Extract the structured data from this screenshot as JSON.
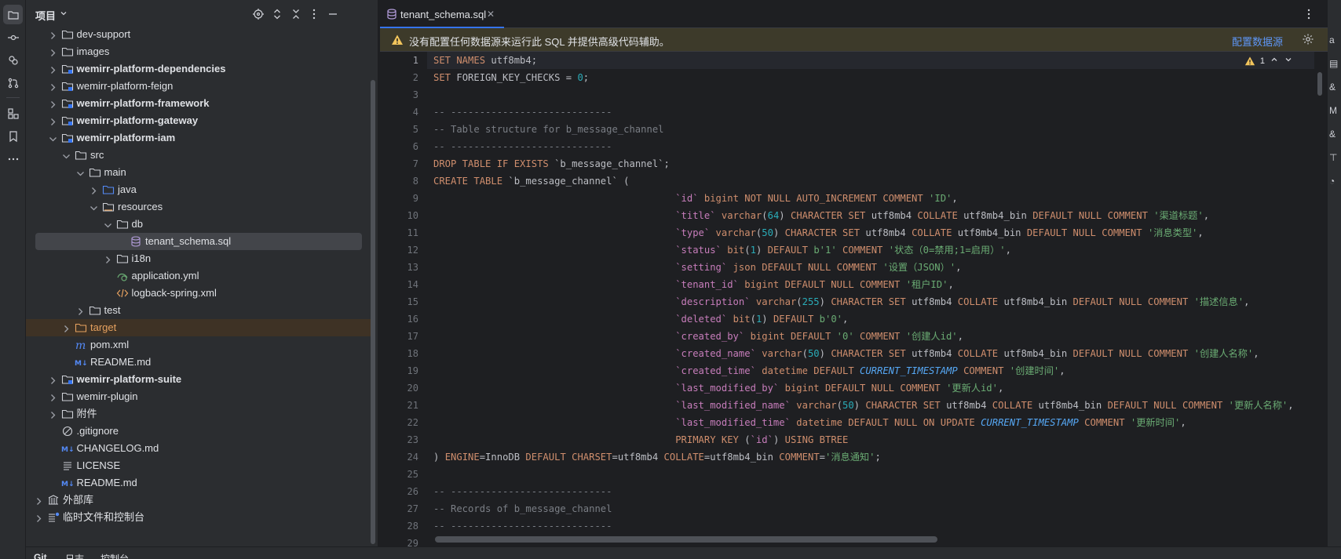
{
  "project_panel": {
    "title": "项目",
    "tree": [
      {
        "label": "dev-support",
        "depth": 1,
        "kind": "folder",
        "chev": "right",
        "bold": false
      },
      {
        "label": "images",
        "depth": 1,
        "kind": "folder",
        "chev": "right",
        "bold": false
      },
      {
        "label": "wemirr-platform-dependencies",
        "depth": 1,
        "kind": "module",
        "chev": "right",
        "bold": true
      },
      {
        "label": "wemirr-platform-feign",
        "depth": 1,
        "kind": "module",
        "chev": "right",
        "bold": false
      },
      {
        "label": "wemirr-platform-framework",
        "depth": 1,
        "kind": "module",
        "chev": "right",
        "bold": true
      },
      {
        "label": "wemirr-platform-gateway",
        "depth": 1,
        "kind": "module",
        "chev": "right",
        "bold": true
      },
      {
        "label": "wemirr-platform-iam",
        "depth": 1,
        "kind": "module",
        "chev": "down",
        "bold": true
      },
      {
        "label": "src",
        "depth": 2,
        "kind": "folder",
        "chev": "down",
        "bold": false
      },
      {
        "label": "main",
        "depth": 3,
        "kind": "folder",
        "chev": "down",
        "bold": false
      },
      {
        "label": "java",
        "depth": 4,
        "kind": "source",
        "chev": "right",
        "bold": false
      },
      {
        "label": "resources",
        "depth": 4,
        "kind": "resources",
        "chev": "down",
        "bold": false
      },
      {
        "label": "db",
        "depth": 5,
        "kind": "folder",
        "chev": "down",
        "bold": false
      },
      {
        "label": "tenant_schema.sql",
        "depth": 6,
        "kind": "sql",
        "chev": "none",
        "bold": false,
        "selected": true
      },
      {
        "label": "i18n",
        "depth": 5,
        "kind": "folder",
        "chev": "right",
        "bold": false
      },
      {
        "label": "application.yml",
        "depth": 5,
        "kind": "yml",
        "chev": "none",
        "bold": false
      },
      {
        "label": "logback-spring.xml",
        "depth": 5,
        "kind": "xml",
        "chev": "none",
        "bold": false
      },
      {
        "label": "test",
        "depth": 3,
        "kind": "folder",
        "chev": "right",
        "bold": false
      },
      {
        "label": "target",
        "depth": 2,
        "kind": "excluded",
        "chev": "right",
        "bold": false
      },
      {
        "label": "pom.xml",
        "depth": 2,
        "kind": "maven",
        "chev": "none",
        "bold": false
      },
      {
        "label": "README.md",
        "depth": 2,
        "kind": "md",
        "chev": "none",
        "bold": false
      },
      {
        "label": "wemirr-platform-suite",
        "depth": 1,
        "kind": "module",
        "chev": "right",
        "bold": true
      },
      {
        "label": "wemirr-plugin",
        "depth": 1,
        "kind": "folder",
        "chev": "right",
        "bold": false
      },
      {
        "label": "附件",
        "depth": 1,
        "kind": "folder",
        "chev": "right",
        "bold": false
      },
      {
        "label": ".gitignore",
        "depth": 1,
        "kind": "ignore",
        "chev": "none",
        "bold": false
      },
      {
        "label": "CHANGELOG.md",
        "depth": 1,
        "kind": "md",
        "chev": "none",
        "bold": false
      },
      {
        "label": "LICENSE",
        "depth": 1,
        "kind": "text",
        "chev": "none",
        "bold": false
      },
      {
        "label": "README.md",
        "depth": 1,
        "kind": "md",
        "chev": "none",
        "bold": false
      },
      {
        "label": "外部库",
        "depth": 0,
        "kind": "library",
        "chev": "right",
        "bold": false
      },
      {
        "label": "临时文件和控制台",
        "depth": 0,
        "kind": "scratch",
        "chev": "right",
        "bold": false
      }
    ]
  },
  "bottom_tabs": [
    "Git",
    "日志",
    "控制台"
  ],
  "editor": {
    "tab_label": "tenant_schema.sql",
    "banner_text": "没有配置任何数据源来运行此 SQL 并提供高级代码辅助。",
    "banner_link": "配置数据源",
    "inspection_count": "1",
    "current_line": 1,
    "lines": [
      [
        [
          "k",
          "SET NAMES "
        ],
        [
          "t",
          "utf8mb4;"
        ]
      ],
      [
        [
          "k",
          "SET "
        ],
        [
          "t",
          "FOREIGN_KEY_CHECKS = "
        ],
        [
          "n",
          "0"
        ],
        [
          "t",
          ";"
        ]
      ],
      [],
      [
        [
          "c",
          "-- ----------------------------"
        ]
      ],
      [
        [
          "c",
          "-- Table structure for b_message_channel"
        ]
      ],
      [
        [
          "c",
          "-- ----------------------------"
        ]
      ],
      [
        [
          "k",
          "DROP TABLE IF EXISTS "
        ],
        [
          "t",
          "`b_message_channel`;"
        ]
      ],
      [
        [
          "k",
          "CREATE TABLE "
        ],
        [
          "t",
          "`b_message_channel` ("
        ]
      ],
      [
        [
          "t",
          "                                          "
        ],
        [
          "bq",
          "`id`"
        ],
        [
          "k",
          " bigint NOT NULL AUTO_INCREMENT COMMENT "
        ],
        [
          "s",
          "'ID'"
        ],
        [
          "t",
          ","
        ]
      ],
      [
        [
          "t",
          "                                          "
        ],
        [
          "bq",
          "`title`"
        ],
        [
          "k",
          " varchar"
        ],
        [
          "t",
          "("
        ],
        [
          "n",
          "64"
        ],
        [
          "t",
          ") "
        ],
        [
          "k",
          "CHARACTER SET "
        ],
        [
          "t",
          "utf8mb4 "
        ],
        [
          "k",
          "COLLATE "
        ],
        [
          "t",
          "utf8mb4_bin "
        ],
        [
          "k",
          "DEFAULT NULL COMMENT "
        ],
        [
          "s",
          "'渠道标题'"
        ],
        [
          "t",
          ","
        ]
      ],
      [
        [
          "t",
          "                                          "
        ],
        [
          "bq",
          "`type`"
        ],
        [
          "k",
          " varchar"
        ],
        [
          "t",
          "("
        ],
        [
          "n",
          "50"
        ],
        [
          "t",
          ") "
        ],
        [
          "k",
          "CHARACTER SET "
        ],
        [
          "t",
          "utf8mb4 "
        ],
        [
          "k",
          "COLLATE "
        ],
        [
          "t",
          "utf8mb4_bin "
        ],
        [
          "k",
          "DEFAULT NULL COMMENT "
        ],
        [
          "s",
          "'消息类型'"
        ],
        [
          "t",
          ","
        ]
      ],
      [
        [
          "t",
          "                                          "
        ],
        [
          "bq",
          "`status`"
        ],
        [
          "k",
          " bit"
        ],
        [
          "t",
          "("
        ],
        [
          "n",
          "1"
        ],
        [
          "t",
          ") "
        ],
        [
          "k",
          "DEFAULT "
        ],
        [
          "s",
          "b'1'"
        ],
        [
          "k",
          " COMMENT "
        ],
        [
          "s",
          "'状态（0=禁用;1=启用）'"
        ],
        [
          "t",
          ","
        ]
      ],
      [
        [
          "t",
          "                                          "
        ],
        [
          "bq",
          "`setting`"
        ],
        [
          "k",
          " json DEFAULT NULL COMMENT "
        ],
        [
          "s",
          "'设置（JSON）'"
        ],
        [
          "t",
          ","
        ]
      ],
      [
        [
          "t",
          "                                          "
        ],
        [
          "bq",
          "`tenant_id`"
        ],
        [
          "k",
          " bigint DEFAULT NULL COMMENT "
        ],
        [
          "s",
          "'租户ID'"
        ],
        [
          "t",
          ","
        ]
      ],
      [
        [
          "t",
          "                                          "
        ],
        [
          "bq",
          "`description`"
        ],
        [
          "k",
          " varchar"
        ],
        [
          "t",
          "("
        ],
        [
          "n",
          "255"
        ],
        [
          "t",
          ") "
        ],
        [
          "k",
          "CHARACTER SET "
        ],
        [
          "t",
          "utf8mb4 "
        ],
        [
          "k",
          "COLLATE "
        ],
        [
          "t",
          "utf8mb4_bin "
        ],
        [
          "k",
          "DEFAULT NULL COMMENT "
        ],
        [
          "s",
          "'描述信息'"
        ],
        [
          "t",
          ","
        ]
      ],
      [
        [
          "t",
          "                                          "
        ],
        [
          "bq",
          "`deleted`"
        ],
        [
          "k",
          " bit"
        ],
        [
          "t",
          "("
        ],
        [
          "n",
          "1"
        ],
        [
          "t",
          ") "
        ],
        [
          "k",
          "DEFAULT "
        ],
        [
          "s",
          "b'0'"
        ],
        [
          "t",
          ","
        ]
      ],
      [
        [
          "t",
          "                                          "
        ],
        [
          "bq",
          "`created_by`"
        ],
        [
          "k",
          " bigint DEFAULT "
        ],
        [
          "s",
          "'0'"
        ],
        [
          "k",
          " COMMENT "
        ],
        [
          "s",
          "'创建人id'"
        ],
        [
          "t",
          ","
        ]
      ],
      [
        [
          "t",
          "                                          "
        ],
        [
          "bq",
          "`created_name`"
        ],
        [
          "k",
          " varchar"
        ],
        [
          "t",
          "("
        ],
        [
          "n",
          "50"
        ],
        [
          "t",
          ") "
        ],
        [
          "k",
          "CHARACTER SET "
        ],
        [
          "t",
          "utf8mb4 "
        ],
        [
          "k",
          "COLLATE "
        ],
        [
          "t",
          "utf8mb4_bin "
        ],
        [
          "k",
          "DEFAULT NULL COMMENT "
        ],
        [
          "s",
          "'创建人名称'"
        ],
        [
          "t",
          ","
        ]
      ],
      [
        [
          "t",
          "                                          "
        ],
        [
          "bq",
          "`created_time`"
        ],
        [
          "k",
          " datetime DEFAULT "
        ],
        [
          "f",
          "CURRENT_TIMESTAMP"
        ],
        [
          "k",
          " COMMENT "
        ],
        [
          "s",
          "'创建时间'"
        ],
        [
          "t",
          ","
        ]
      ],
      [
        [
          "t",
          "                                          "
        ],
        [
          "bq",
          "`last_modified_by`"
        ],
        [
          "k",
          " bigint DEFAULT NULL COMMENT "
        ],
        [
          "s",
          "'更新人id'"
        ],
        [
          "t",
          ","
        ]
      ],
      [
        [
          "t",
          "                                          "
        ],
        [
          "bq",
          "`last_modified_name`"
        ],
        [
          "k",
          " varchar"
        ],
        [
          "t",
          "("
        ],
        [
          "n",
          "50"
        ],
        [
          "t",
          ") "
        ],
        [
          "k",
          "CHARACTER SET "
        ],
        [
          "t",
          "utf8mb4 "
        ],
        [
          "k",
          "COLLATE "
        ],
        [
          "t",
          "utf8mb4_bin "
        ],
        [
          "k",
          "DEFAULT NULL COMMENT "
        ],
        [
          "s",
          "'更新人名称'"
        ],
        [
          "t",
          ","
        ]
      ],
      [
        [
          "t",
          "                                          "
        ],
        [
          "bq",
          "`last_modified_time`"
        ],
        [
          "k",
          " datetime DEFAULT NULL ON UPDATE "
        ],
        [
          "f",
          "CURRENT_TIMESTAMP"
        ],
        [
          "k",
          " COMMENT "
        ],
        [
          "s",
          "'更新时间'"
        ],
        [
          "t",
          ","
        ]
      ],
      [
        [
          "t",
          "                                          "
        ],
        [
          "k",
          "PRIMARY KEY "
        ],
        [
          "t",
          "("
        ],
        [
          "bq",
          "`id`"
        ],
        [
          "t",
          ") "
        ],
        [
          "k",
          "USING BTREE"
        ]
      ],
      [
        [
          "t",
          ") "
        ],
        [
          "k",
          "ENGINE"
        ],
        [
          "t",
          "=InnoDB "
        ],
        [
          "k",
          "DEFAULT CHARSET"
        ],
        [
          "t",
          "=utf8mb4 "
        ],
        [
          "k",
          "COLLATE"
        ],
        [
          "t",
          "=utf8mb4_bin "
        ],
        [
          "k",
          "COMMENT"
        ],
        [
          "t",
          "="
        ],
        [
          "s",
          "'消息通知'"
        ],
        [
          "t",
          ";"
        ]
      ],
      [],
      [
        [
          "c",
          "-- ----------------------------"
        ]
      ],
      [
        [
          "c",
          "-- Records of b_message_channel"
        ]
      ],
      [
        [
          "c",
          "-- ----------------------------"
        ]
      ],
      []
    ]
  }
}
